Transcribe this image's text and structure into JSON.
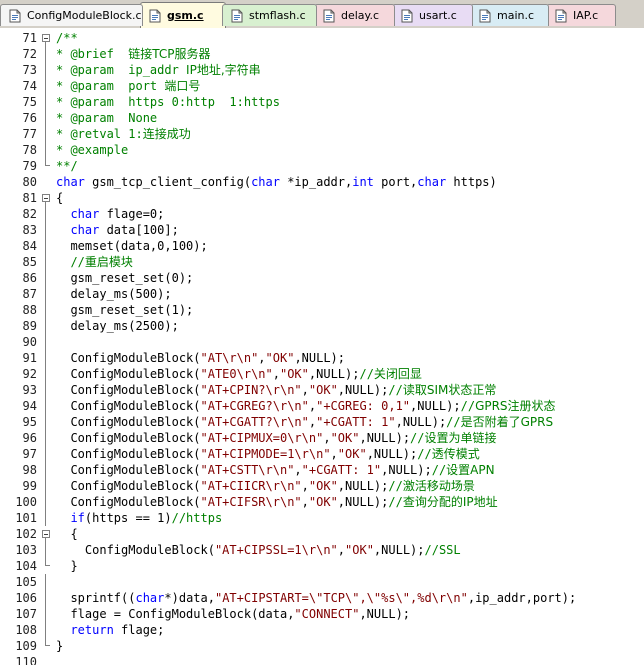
{
  "tabs": [
    {
      "name": "ConfigModuleBlock.c",
      "active": false,
      "color": "#f5f5f5"
    },
    {
      "name": "gsm.c",
      "active": true,
      "color": "#fffbe0"
    },
    {
      "name": "stmflash.c",
      "active": false,
      "color": "#d8f0d0"
    },
    {
      "name": "delay.c",
      "active": false,
      "color": "#f5d8dc"
    },
    {
      "name": "usart.c",
      "active": false,
      "color": "#e8dcf4"
    },
    {
      "name": "main.c",
      "active": false,
      "color": "#d8ecf4"
    },
    {
      "name": "IAP.c",
      "active": false,
      "color": "#f5d8dc"
    }
  ],
  "code_lines": [
    {
      "n": "71",
      "fold": "start",
      "tokens": [
        [
          "c",
          "/**"
        ]
      ]
    },
    {
      "n": "72",
      "fold": "in",
      "tokens": [
        [
          "c",
          "* @brief  "
        ],
        [
          "cn",
          "链接TCP服务器"
        ]
      ]
    },
    {
      "n": "73",
      "fold": "in",
      "tokens": [
        [
          "c",
          "* @param  ip_addr "
        ],
        [
          "cn",
          "IP地址,字符串"
        ]
      ]
    },
    {
      "n": "74",
      "fold": "in",
      "tokens": [
        [
          "c",
          "* @param  port "
        ],
        [
          "cn",
          "端口号"
        ]
      ]
    },
    {
      "n": "75",
      "fold": "in",
      "tokens": [
        [
          "c",
          "* @param  https 0:http  1:https"
        ]
      ]
    },
    {
      "n": "76",
      "fold": "in",
      "tokens": [
        [
          "c",
          "* @param  None"
        ]
      ]
    },
    {
      "n": "77",
      "fold": "in",
      "tokens": [
        [
          "c",
          "* @retval 1:"
        ],
        [
          "cn",
          "连接成功"
        ]
      ]
    },
    {
      "n": "78",
      "fold": "in",
      "tokens": [
        [
          "c",
          "* @example"
        ]
      ]
    },
    {
      "n": "79",
      "fold": "end",
      "tokens": [
        [
          "c",
          "**/"
        ]
      ]
    },
    {
      "n": "80",
      "fold": "",
      "tokens": [
        [
          "k",
          "char"
        ],
        [
          "p",
          " gsm_tcp_client_config("
        ],
        [
          "k",
          "char"
        ],
        [
          "p",
          " *ip_addr,"
        ],
        [
          "k",
          "int"
        ],
        [
          "p",
          " port,"
        ],
        [
          "k",
          "char"
        ],
        [
          "p",
          " https)"
        ]
      ]
    },
    {
      "n": "81",
      "fold": "start",
      "tokens": [
        [
          "p",
          "{"
        ]
      ]
    },
    {
      "n": "82",
      "fold": "in",
      "tokens": [
        [
          "p",
          "  "
        ],
        [
          "k",
          "char"
        ],
        [
          "p",
          " flage=0;"
        ]
      ]
    },
    {
      "n": "83",
      "fold": "in",
      "tokens": [
        [
          "p",
          "  "
        ],
        [
          "k",
          "char"
        ],
        [
          "p",
          " data[100];"
        ]
      ]
    },
    {
      "n": "84",
      "fold": "in",
      "tokens": [
        [
          "p",
          "  memset(data,0,100);"
        ]
      ]
    },
    {
      "n": "85",
      "fold": "in",
      "tokens": [
        [
          "p",
          "  "
        ],
        [
          "c",
          "//"
        ],
        [
          "cn",
          "重启模块"
        ]
      ]
    },
    {
      "n": "86",
      "fold": "in",
      "tokens": [
        [
          "p",
          "  gsm_reset_set(0);"
        ]
      ]
    },
    {
      "n": "87",
      "fold": "in",
      "tokens": [
        [
          "p",
          "  delay_ms(500);"
        ]
      ]
    },
    {
      "n": "88",
      "fold": "in",
      "tokens": [
        [
          "p",
          "  gsm_reset_set(1);"
        ]
      ]
    },
    {
      "n": "89",
      "fold": "in",
      "tokens": [
        [
          "p",
          "  delay_ms(2500);"
        ]
      ]
    },
    {
      "n": "90",
      "fold": "in",
      "tokens": []
    },
    {
      "n": "91",
      "fold": "in",
      "tokens": [
        [
          "p",
          "  ConfigModuleBlock("
        ],
        [
          "s",
          "\"AT\\r\\n\""
        ],
        [
          "p",
          ","
        ],
        [
          "s",
          "\"OK\""
        ],
        [
          "p",
          ",NULL);"
        ]
      ]
    },
    {
      "n": "92",
      "fold": "in",
      "tokens": [
        [
          "p",
          "  ConfigModuleBlock("
        ],
        [
          "s",
          "\"ATE0\\r\\n\""
        ],
        [
          "p",
          ","
        ],
        [
          "s",
          "\"OK\""
        ],
        [
          "p",
          ",NULL);"
        ],
        [
          "c",
          "//"
        ],
        [
          "cn",
          "关闭回显"
        ]
      ]
    },
    {
      "n": "93",
      "fold": "in",
      "tokens": [
        [
          "p",
          "  ConfigModuleBlock("
        ],
        [
          "s",
          "\"AT+CPIN?\\r\\n\""
        ],
        [
          "p",
          ","
        ],
        [
          "s",
          "\"OK\""
        ],
        [
          "p",
          ",NULL);"
        ],
        [
          "c",
          "//"
        ],
        [
          "cn",
          "读取SIM状态正常"
        ]
      ]
    },
    {
      "n": "94",
      "fold": "in",
      "tokens": [
        [
          "p",
          "  ConfigModuleBlock("
        ],
        [
          "s",
          "\"AT+CGREG?\\r\\n\""
        ],
        [
          "p",
          ","
        ],
        [
          "s",
          "\"+CGREG: 0,1\""
        ],
        [
          "p",
          ",NULL);"
        ],
        [
          "c",
          "//"
        ],
        [
          "cn",
          "GPRS注册状态"
        ]
      ]
    },
    {
      "n": "95",
      "fold": "in",
      "tokens": [
        [
          "p",
          "  ConfigModuleBlock("
        ],
        [
          "s",
          "\"AT+CGATT?\\r\\n\""
        ],
        [
          "p",
          ","
        ],
        [
          "s",
          "\"+CGATT: 1\""
        ],
        [
          "p",
          ",NULL);"
        ],
        [
          "c",
          "//"
        ],
        [
          "cn",
          "是否附着了GPRS"
        ]
      ]
    },
    {
      "n": "96",
      "fold": "in",
      "tokens": [
        [
          "p",
          "  ConfigModuleBlock("
        ],
        [
          "s",
          "\"AT+CIPMUX=0\\r\\n\""
        ],
        [
          "p",
          ","
        ],
        [
          "s",
          "\"OK\""
        ],
        [
          "p",
          ",NULL);"
        ],
        [
          "c",
          "//"
        ],
        [
          "cn",
          "设置为单链接"
        ]
      ]
    },
    {
      "n": "97",
      "fold": "in",
      "tokens": [
        [
          "p",
          "  ConfigModuleBlock("
        ],
        [
          "s",
          "\"AT+CIPMODE=1\\r\\n\""
        ],
        [
          "p",
          ","
        ],
        [
          "s",
          "\"OK\""
        ],
        [
          "p",
          ",NULL);"
        ],
        [
          "c",
          "//"
        ],
        [
          "cn",
          "透传模式"
        ]
      ]
    },
    {
      "n": "98",
      "fold": "in",
      "tokens": [
        [
          "p",
          "  ConfigModuleBlock("
        ],
        [
          "s",
          "\"AT+CSTT\\r\\n\""
        ],
        [
          "p",
          ","
        ],
        [
          "s",
          "\"+CGATT: 1\""
        ],
        [
          "p",
          ",NULL);"
        ],
        [
          "c",
          "//"
        ],
        [
          "cn",
          "设置APN"
        ]
      ]
    },
    {
      "n": "99",
      "fold": "in",
      "tokens": [
        [
          "p",
          "  ConfigModuleBlock("
        ],
        [
          "s",
          "\"AT+CIICR\\r\\n\""
        ],
        [
          "p",
          ","
        ],
        [
          "s",
          "\"OK\""
        ],
        [
          "p",
          ",NULL);"
        ],
        [
          "c",
          "//"
        ],
        [
          "cn",
          "激活移动场景"
        ]
      ]
    },
    {
      "n": "100",
      "fold": "in",
      "tokens": [
        [
          "p",
          "  ConfigModuleBlock("
        ],
        [
          "s",
          "\"AT+CIFSR\\r\\n\""
        ],
        [
          "p",
          ","
        ],
        [
          "s",
          "\"OK\""
        ],
        [
          "p",
          ",NULL);"
        ],
        [
          "c",
          "//"
        ],
        [
          "cn",
          "查询分配的IP地址"
        ]
      ]
    },
    {
      "n": "101",
      "fold": "in",
      "tokens": [
        [
          "p",
          "  "
        ],
        [
          "k",
          "if"
        ],
        [
          "p",
          "(https == 1)"
        ],
        [
          "c",
          "//https"
        ]
      ]
    },
    {
      "n": "102",
      "fold": "start",
      "tokens": [
        [
          "p",
          "  {"
        ]
      ]
    },
    {
      "n": "103",
      "fold": "in",
      "tokens": [
        [
          "p",
          "    ConfigModuleBlock("
        ],
        [
          "s",
          "\"AT+CIPSSL=1\\r\\n\""
        ],
        [
          "p",
          ","
        ],
        [
          "s",
          "\"OK\""
        ],
        [
          "p",
          ",NULL);"
        ],
        [
          "c",
          "//SSL"
        ]
      ]
    },
    {
      "n": "104",
      "fold": "end",
      "tokens": [
        [
          "p",
          "  }"
        ]
      ]
    },
    {
      "n": "105",
      "fold": "in",
      "tokens": []
    },
    {
      "n": "106",
      "fold": "in",
      "tokens": [
        [
          "p",
          "  sprintf(("
        ],
        [
          "k",
          "char"
        ],
        [
          "p",
          "*)data,"
        ],
        [
          "s",
          "\"AT+CIPSTART=\\\"TCP\\\",\\\"%s\\\",%d\\r\\n\""
        ],
        [
          "p",
          ",ip_addr,port);"
        ]
      ]
    },
    {
      "n": "107",
      "fold": "in",
      "tokens": [
        [
          "p",
          "  flage = ConfigModuleBlock(data,"
        ],
        [
          "s",
          "\"CONNECT\""
        ],
        [
          "p",
          ",NULL);"
        ]
      ]
    },
    {
      "n": "108",
      "fold": "in",
      "tokens": [
        [
          "p",
          "  "
        ],
        [
          "k",
          "return"
        ],
        [
          "p",
          " flage;"
        ]
      ]
    },
    {
      "n": "109",
      "fold": "end",
      "tokens": [
        [
          "p",
          "}"
        ]
      ]
    },
    {
      "n": "110",
      "fold": "",
      "tokens": []
    }
  ]
}
